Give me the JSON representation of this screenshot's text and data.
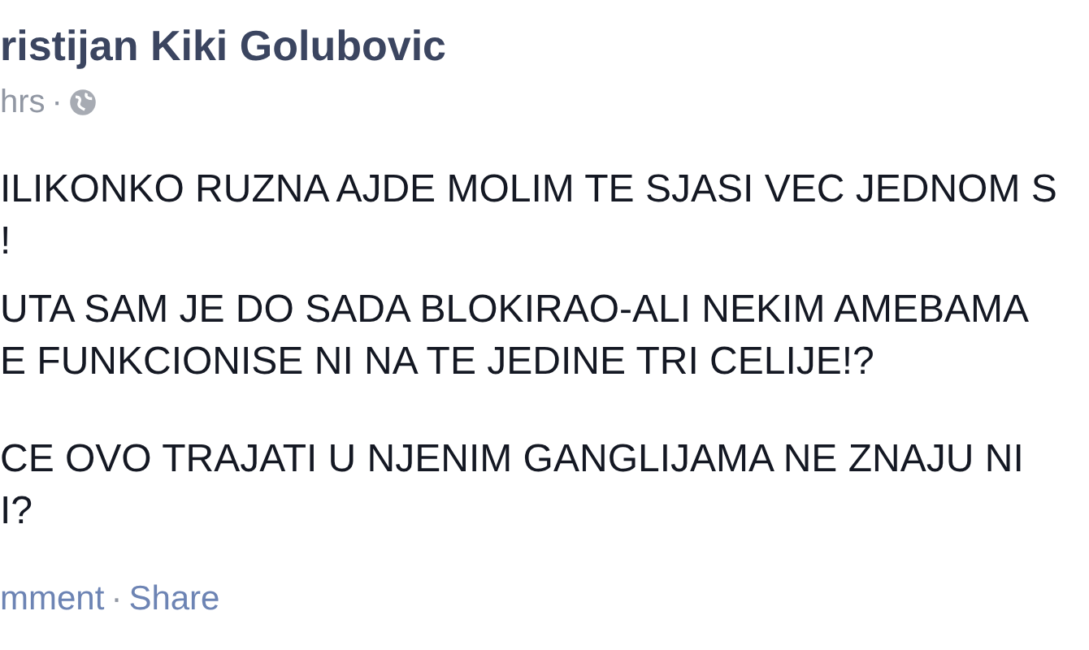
{
  "post": {
    "author": "ristijan Kiki Golubovic",
    "time": "hrs",
    "paragraphs": [
      [
        "ILIKONKO RUZNA AJDE MOLIM TE SJASI VEC JEDNOM S",
        "!"
      ],
      [
        "UTA SAM JE DO SADA BLOKIRAO-ALI NEKIM AMEBAMA",
        "E FUNKCIONISE NI NA TE JEDINE TRI CELIJE!?"
      ],
      [
        "CE OVO TRAJATI U NJENIM GANGLIJAMA NE ZNAJU NI",
        "I?"
      ]
    ],
    "actions": [
      "mment",
      "Share"
    ],
    "separator": "·"
  }
}
